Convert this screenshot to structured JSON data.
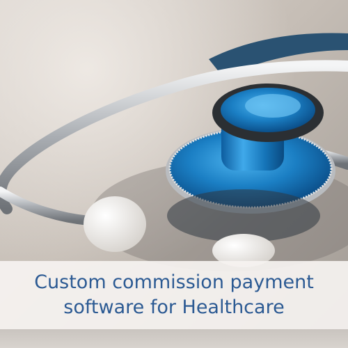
{
  "image": {
    "subject": "stethoscope",
    "colors": {
      "background": "#cfc9c3",
      "chestpiece": "#1e7fc0",
      "tubing": "#2a5272",
      "metal": "#c9ccd0",
      "caption_text": "#2c5a93",
      "caption_bg": "#f6f3f1"
    }
  },
  "caption": {
    "line1": "Custom commission payment",
    "line2": "software for Healthcare"
  }
}
